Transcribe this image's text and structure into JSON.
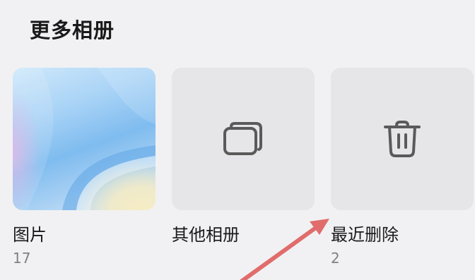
{
  "section": {
    "title": "更多相册"
  },
  "albums": [
    {
      "name": "图片",
      "count": "17",
      "thumb": "photo-wallpaper"
    },
    {
      "name": "其他相册",
      "count": "",
      "thumb": "albums-stack-icon"
    },
    {
      "name": "最近删除",
      "count": "2",
      "thumb": "trash-icon"
    }
  ],
  "colors": {
    "background": "#f1f1f3",
    "tile": "#e6e6e8",
    "icon": "#5a5a5a",
    "annotation_arrow": "#e06c6c"
  }
}
